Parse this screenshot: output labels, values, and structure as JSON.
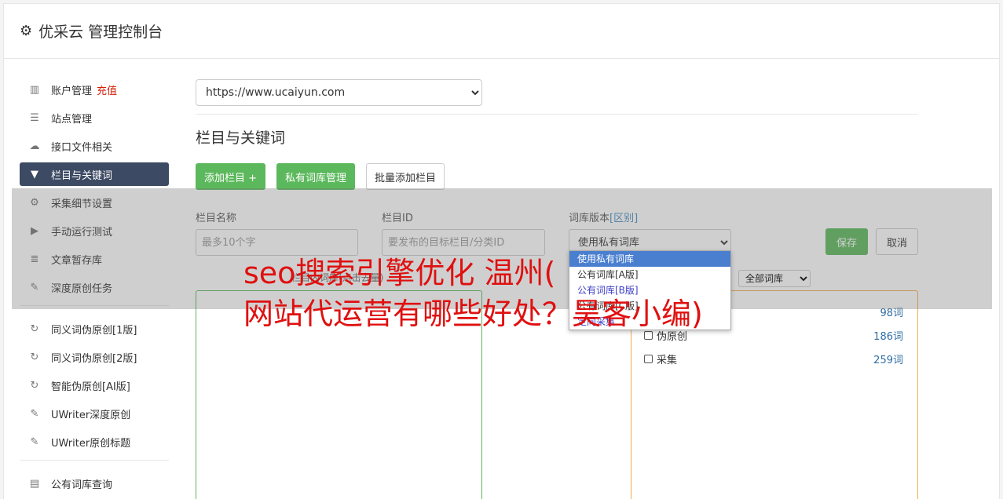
{
  "header": {
    "title": "优采云 管理控制台",
    "icon": "gear-icon"
  },
  "sidebar": {
    "items": [
      {
        "label": "账户管理",
        "extra": "充值",
        "icon": "bar-chart-icon"
      },
      {
        "label": "站点管理",
        "icon": "server-icon"
      },
      {
        "label": "接口文件相关",
        "icon": "cloud-upload-icon"
      },
      {
        "label": "栏目与关键词",
        "icon": "filter-icon",
        "active": true
      },
      {
        "label": "采集细节设置",
        "icon": "gears-icon"
      },
      {
        "label": "手动运行测试",
        "icon": "play-circle-icon"
      },
      {
        "label": "文章暂存库",
        "icon": "database-icon"
      },
      {
        "label": "深度原创任务",
        "icon": "edit-icon"
      }
    ],
    "items2": [
      {
        "label": "同义词伪原创[1版]",
        "icon": "refresh-icon"
      },
      {
        "label": "同义词伪原创[2版]",
        "icon": "refresh-icon"
      },
      {
        "label": "智能伪原创[AI版]",
        "icon": "refresh-icon"
      },
      {
        "label": "UWriter深度原创",
        "icon": "edit-icon"
      },
      {
        "label": "UWriter原创标题",
        "icon": "edit-icon"
      }
    ],
    "items3": [
      {
        "label": "公有词库查询",
        "icon": "book-icon"
      }
    ]
  },
  "main": {
    "site_select": "https://www.ucaiyun.com",
    "section_title": "栏目与关键词",
    "buttons": {
      "add_column": "添加栏目 +",
      "private_lib": "私有词库管理",
      "batch_add": "批量添加栏目"
    },
    "form": {
      "name_label": "栏目名称",
      "name_placeholder": "最多10个字",
      "id_label": "栏目ID",
      "id_placeholder": "要发布的目标栏目/分类ID",
      "lib_label": "词库版本",
      "lib_label_link": "[区别]",
      "lib_value": "使用私有词库",
      "save": "保存",
      "cancel": "取消"
    },
    "dropdown_options": [
      "使用私有词库",
      "公有词库[A版]",
      "公有词库[B版]",
      "公有词库[C版]",
      "定向采集"
    ],
    "left_panel_label": "栏目内词库(点击去量)",
    "lib_filter": "全部词库",
    "lib_rows": [
      {
        "label": "",
        "count": "98词"
      },
      {
        "label": "伪原创",
        "count": "186词"
      },
      {
        "label": "采集",
        "count": "259词"
      }
    ]
  },
  "ad_text": [
    "seo搜索引擎优化 温州(",
    "网站代运营有哪些好处？昊客小编)"
  ]
}
